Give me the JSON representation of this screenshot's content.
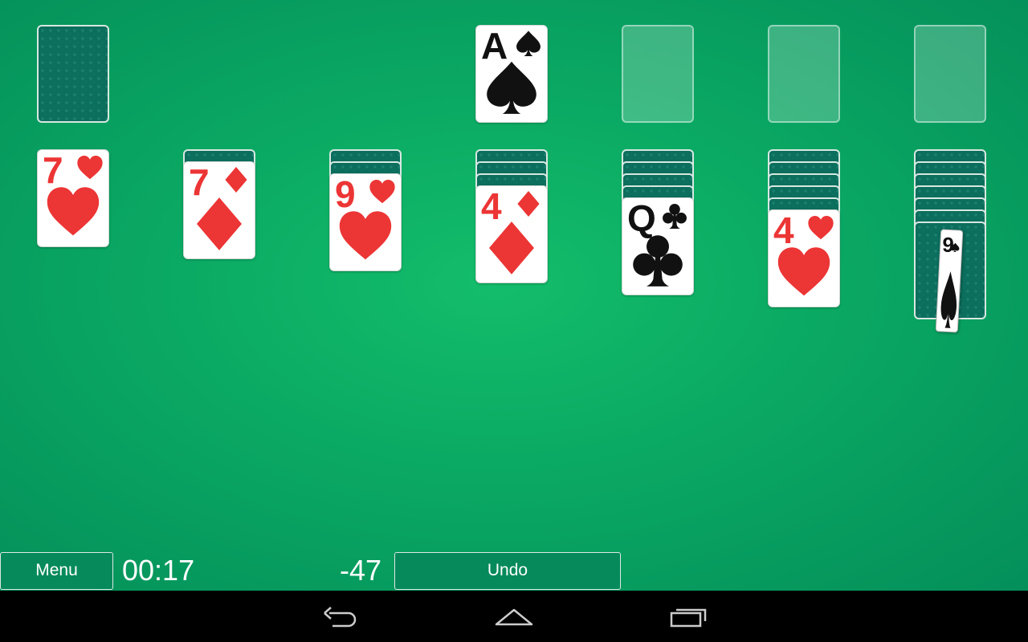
{
  "stock": {
    "state": "face-down"
  },
  "foundations": [
    {
      "rank": "A",
      "suit": "spade",
      "color": "black"
    },
    {
      "state": "empty"
    },
    {
      "state": "empty"
    },
    {
      "state": "empty"
    }
  ],
  "tableau": [
    {
      "hidden": 0,
      "top": {
        "rank": "7",
        "suit": "heart",
        "color": "red"
      }
    },
    {
      "hidden": 1,
      "top": {
        "rank": "7",
        "suit": "diamond",
        "color": "red"
      }
    },
    {
      "hidden": 2,
      "top": {
        "rank": "9",
        "suit": "heart",
        "color": "red"
      }
    },
    {
      "hidden": 3,
      "top": {
        "rank": "4",
        "suit": "diamond",
        "color": "red"
      }
    },
    {
      "hidden": 4,
      "top": {
        "rank": "Q",
        "suit": "club",
        "color": "black"
      }
    },
    {
      "hidden": 5,
      "top": {
        "rank": "4",
        "suit": "heart",
        "color": "red"
      }
    },
    {
      "hidden": 6,
      "top": {
        "rank": "9",
        "suit": "spade",
        "color": "black"
      },
      "top_state": "flipping"
    }
  ],
  "toolbar": {
    "menu_label": "Menu",
    "timer": "00:17",
    "score": "-47",
    "undo_label": "Undo"
  },
  "colors": {
    "felt": "#0aa863",
    "red_suit": "#ec3535",
    "black_suit": "#111111",
    "card_back": "#0c6e5c"
  },
  "system_nav": {
    "icons": [
      "back-icon",
      "home-icon",
      "recent-apps-icon"
    ]
  }
}
